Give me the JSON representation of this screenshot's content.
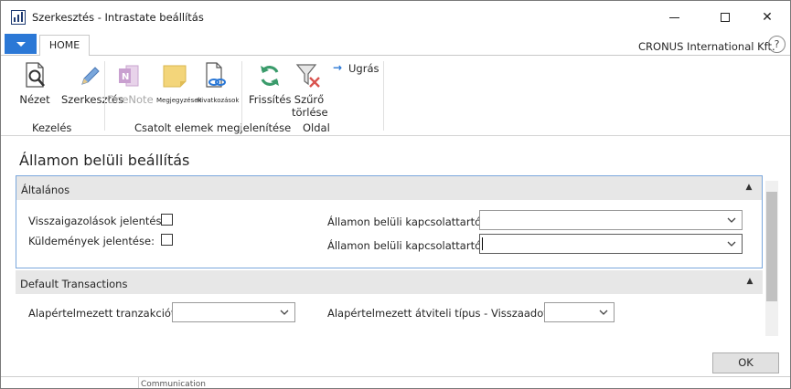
{
  "window": {
    "title": "Szerkesztés - Intrastate beállítás",
    "minimize": "minimize",
    "maximize": "maximize",
    "close": "✕"
  },
  "tabs": {
    "home": "HOME"
  },
  "company": "CRONUS International Kft.",
  "help": "?",
  "ribbon": {
    "groups": {
      "kezeles": "Kezelés",
      "csatolt": "Csatolt elemek megjelenítése",
      "oldal": "Oldal"
    },
    "buttons": {
      "nezet": "Nézet",
      "szerkesztes": "Szerkesztés",
      "onenote": "OneNote",
      "megjegyzesek": "Megjegyzések",
      "hivatkozasok": "Hivatkozások",
      "frissites": "Frissítés",
      "szuro_line1": "Szűrő",
      "szuro_line2": "törlése",
      "ugras": "Ugrás"
    }
  },
  "page": {
    "title": "Államon belüli beállítás"
  },
  "general": {
    "title": "Általános",
    "visszaig_label": "Visszaigazolások jelentése:",
    "kuldemenyek_label": "Küldemények jelentése:",
    "kapcs_tipus_label": "Államon belüli kapcsolattartó típusa:",
    "kapcs_tipus_value": "",
    "kapcs_szam_label": "Államon belüli kapcsolattartó száma:",
    "kapcs_szam_value": ""
  },
  "default_transactions": {
    "title": "Default Transactions",
    "tranz_label": "Alapértelmezett tranzakciótípus:",
    "tranz_value": "",
    "atviteli_label": "Alapértelmezett átviteli típus - Visszaadott érték:",
    "atviteli_value": ""
  },
  "ok_label": "OK",
  "footer_text": "Communication",
  "colors": {
    "accent": "#2b78d6",
    "fasttab_border": "#7aa7dc",
    "header_bg": "#e7e7e7"
  }
}
